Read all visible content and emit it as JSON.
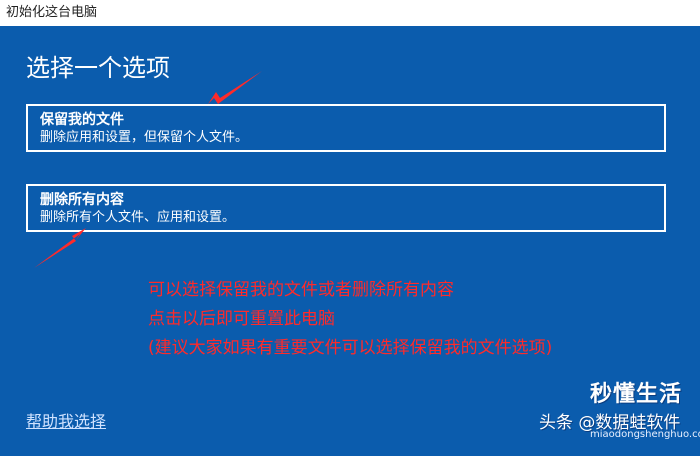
{
  "window": {
    "title": "初始化这台电脑"
  },
  "main": {
    "heading": "选择一个选项",
    "options": [
      {
        "title": "保留我的文件",
        "description": "删除应用和设置，但保留个人文件。"
      },
      {
        "title": "删除所有内容",
        "description": "删除所有个人文件、应用和设置。"
      }
    ],
    "help_link": "帮助我选择"
  },
  "annotation": {
    "lines": [
      "可以选择保留我的文件或者删除所有内容",
      "点击以后即可重置此电脑",
      "(建议大家如果有重要文件可以选择保留我的文件选项)"
    ],
    "color": "#ff2a2a"
  },
  "watermark": {
    "brand": "秒懂生活",
    "source": "头条 @数据蛙软件",
    "url": "miaodongshenghuo.com"
  },
  "colors": {
    "panel": "#0b5cad",
    "border": "#ffffff",
    "arrow": "#ff2a2a"
  }
}
